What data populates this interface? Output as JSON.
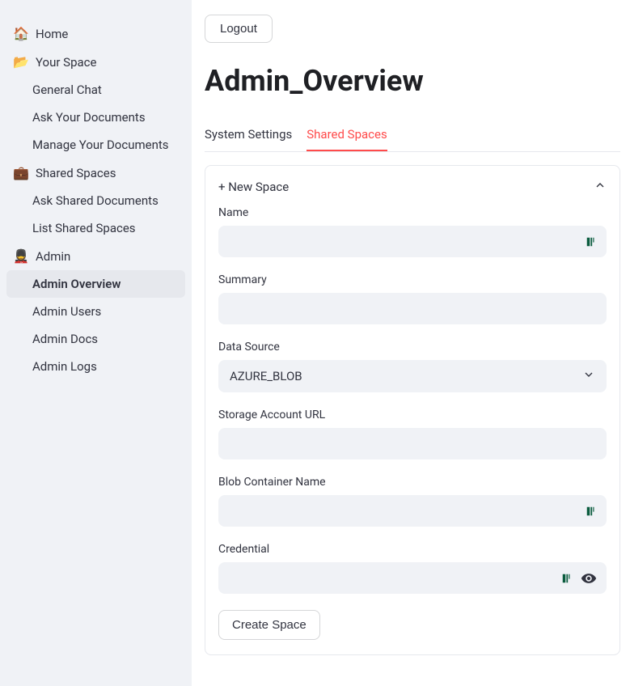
{
  "sidebar": {
    "items": [
      {
        "icon": "🏠",
        "label": "Home"
      },
      {
        "icon": "📂",
        "label": "Your Space"
      },
      {
        "label": "General Chat"
      },
      {
        "label": "Ask Your Documents"
      },
      {
        "label": "Manage Your Documents"
      },
      {
        "icon": "💼",
        "label": "Shared Spaces"
      },
      {
        "label": "Ask Shared Documents"
      },
      {
        "label": "List Shared Spaces"
      },
      {
        "icon": "💂",
        "label": "Admin"
      },
      {
        "label": "Admin Overview"
      },
      {
        "label": "Admin Users"
      },
      {
        "label": "Admin Docs"
      },
      {
        "label": "Admin Logs"
      }
    ]
  },
  "header": {
    "logout_label": "Logout",
    "page_title": "Admin_Overview"
  },
  "tabs": {
    "system_settings": "System Settings",
    "shared_spaces": "Shared Spaces"
  },
  "panel": {
    "header": "+ New Space",
    "fields": {
      "name_label": "Name",
      "summary_label": "Summary",
      "data_source_label": "Data Source",
      "data_source_value": "AZURE_BLOB",
      "storage_url_label": "Storage Account URL",
      "blob_container_label": "Blob Container Name",
      "credential_label": "Credential"
    },
    "create_button": "Create Space"
  }
}
